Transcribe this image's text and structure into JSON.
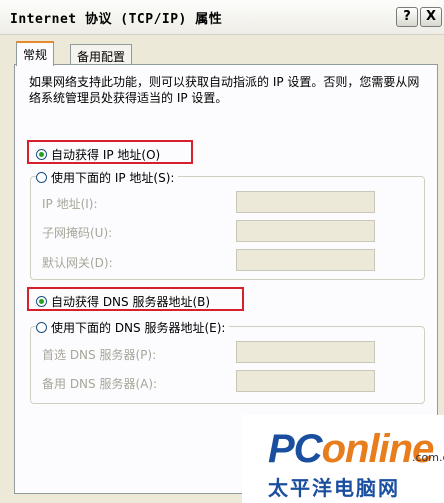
{
  "window": {
    "title": "Internet 协议 (TCP/IP) 属性",
    "help_label": "?",
    "close_label": "X"
  },
  "tabs": [
    {
      "label": "常规"
    },
    {
      "label": "备用配置"
    }
  ],
  "description": "如果网络支持此功能，则可以获取自动指派的 IP 设置。否则，您需要从网络系统管理员处获得适当的 IP 设置。",
  "ip_section": {
    "auto_label": "自动获得 IP 地址(O)",
    "manual_label": "使用下面的 IP 地址(S):",
    "auto_selected": true,
    "fields": [
      {
        "label": "IP 地址(I):",
        "value": ""
      },
      {
        "label": "子网掩码(U):",
        "value": ""
      },
      {
        "label": "默认网关(D):",
        "value": ""
      }
    ]
  },
  "dns_section": {
    "auto_label": "自动获得 DNS 服务器地址(B)",
    "manual_label": "使用下面的 DNS 服务器地址(E):",
    "auto_selected": true,
    "fields": [
      {
        "label": "首选 DNS 服务器(P):",
        "value": ""
      },
      {
        "label": "备用 DNS 服务器(A):",
        "value": ""
      }
    ]
  },
  "watermark": {
    "brand_part1": "PC",
    "brand_part2": "online",
    "domain": ".com.cn",
    "subtitle": "太平洋电脑网"
  },
  "colors": {
    "highlight_border": "#d6202a",
    "radio_dot": "#21a121"
  }
}
